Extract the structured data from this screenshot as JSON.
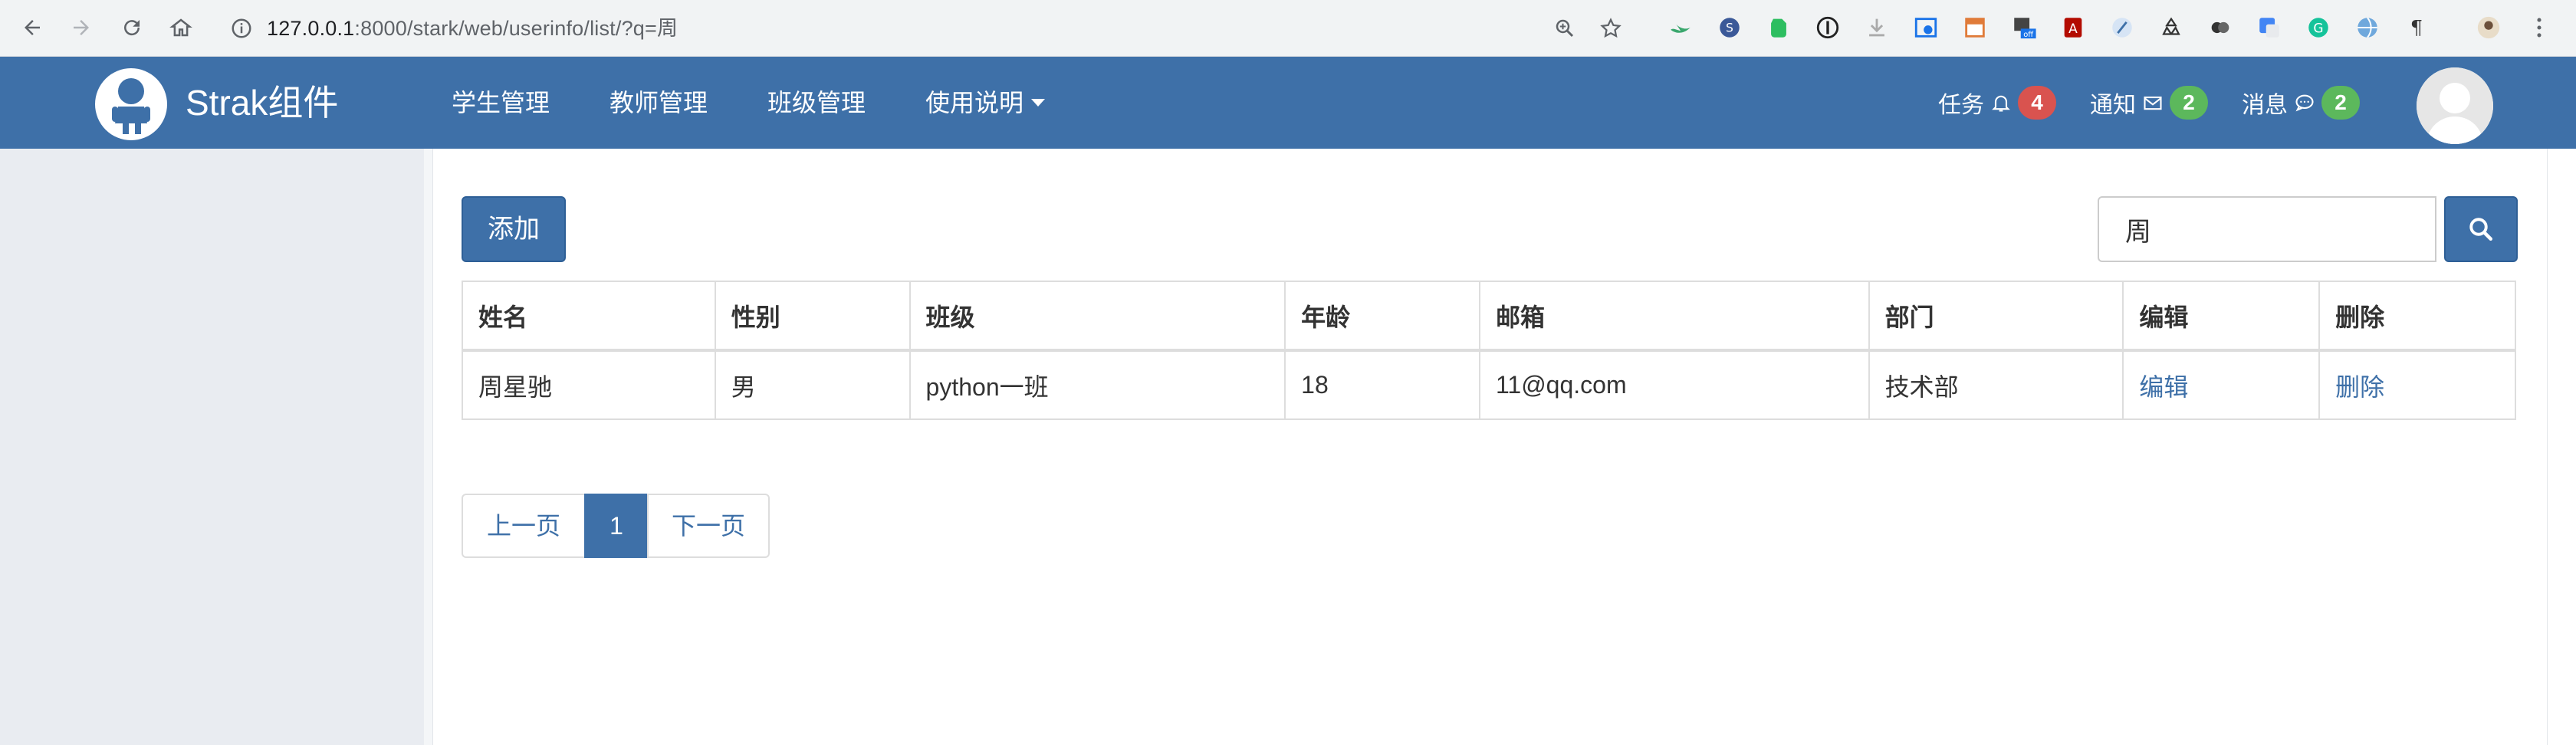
{
  "browser": {
    "url_host": "127.0.0.1",
    "url_rest": ":8000/stark/web/userinfo/list/?q=周"
  },
  "navbar": {
    "brand": "Strak组件",
    "menu": [
      {
        "label": "学生管理"
      },
      {
        "label": "教师管理"
      },
      {
        "label": "班级管理"
      },
      {
        "label": "使用说明"
      }
    ],
    "tasks": {
      "label": "任务",
      "count": "4",
      "icon": "bell-icon"
    },
    "notices": {
      "label": "通知",
      "count": "2",
      "icon": "envelope-icon"
    },
    "messages": {
      "label": "消息",
      "count": "2",
      "icon": "comment-icon"
    }
  },
  "toolbar": {
    "add_label": "添加",
    "search_value": "周"
  },
  "table": {
    "headers": [
      "姓名",
      "性别",
      "班级",
      "年龄",
      "邮箱",
      "部门",
      "编辑",
      "删除"
    ],
    "rows": [
      {
        "name": "周星驰",
        "gender": "男",
        "class": "python一班",
        "age": "18",
        "email": "11@qq.com",
        "dept": "技术部",
        "edit": "编辑",
        "delete": "删除"
      }
    ]
  },
  "pagination": {
    "prev": "上一页",
    "current": "1",
    "next": "下一页"
  },
  "colors": {
    "primary": "#3e70a8",
    "danger": "#d9534f",
    "success": "#5cb85c",
    "sidebar": "#e9ecf1"
  }
}
